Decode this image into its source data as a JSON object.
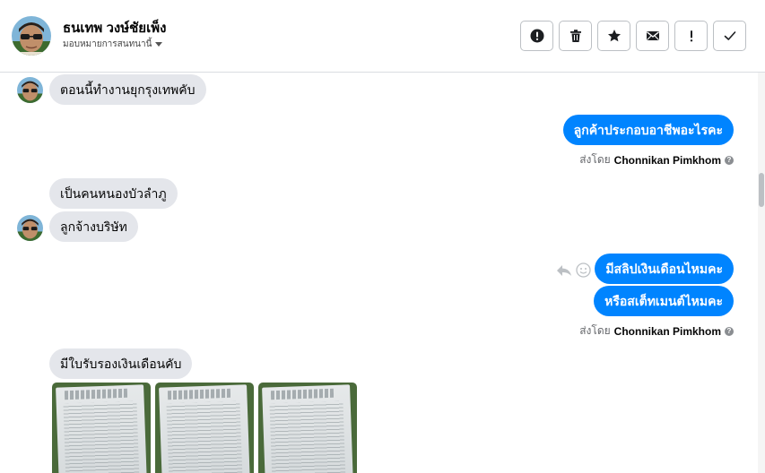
{
  "header": {
    "contact_name": "ธนเทพ วงษ์ชัยเพ็ง",
    "assign_label": "มอบหมายการสนทนานี้",
    "actions": [
      {
        "name": "spam-button",
        "icon": "alert-circle-icon"
      },
      {
        "name": "delete-button",
        "icon": "trash-icon"
      },
      {
        "name": "star-button",
        "icon": "star-icon"
      },
      {
        "name": "mark-unread-button",
        "icon": "envelope-icon"
      },
      {
        "name": "follow-up-button",
        "icon": "exclamation-icon"
      },
      {
        "name": "mark-done-button",
        "icon": "checkmark-icon"
      }
    ]
  },
  "messages": [
    {
      "direction": "in",
      "text": "ตอนนี้ทำงานยุกรุงเทพคับ",
      "show_avatar": true
    },
    {
      "direction": "out",
      "text": "ลูกค้าประกอบอาชีพอะไรคะ"
    },
    {
      "direction": "out-meta",
      "prefix": "ส่งโดย",
      "sender": "Chonnikan Pimkhom"
    },
    {
      "direction": "in",
      "text": "เป็นคนหนองบัวลำภู",
      "show_avatar": false
    },
    {
      "direction": "in",
      "text": "ลูกจ้างบริษัท",
      "show_avatar": true
    },
    {
      "direction": "out",
      "text": "มีสลิปเงินเดือนไหมคะ"
    },
    {
      "direction": "out",
      "text": "หรือสเต็ทเมนต์ไหมคะ"
    },
    {
      "direction": "out-meta",
      "prefix": "ส่งโดย",
      "sender": "Chonnikan Pimkhom"
    },
    {
      "direction": "in",
      "text": "มีใบรับรองเงินเดือนคับ",
      "show_avatar": false
    },
    {
      "direction": "in-photos",
      "count": 3
    }
  ],
  "colors": {
    "outgoing_bubble": "#0084ff",
    "incoming_bubble": "#e4e6eb",
    "meta_text": "#65676b"
  }
}
